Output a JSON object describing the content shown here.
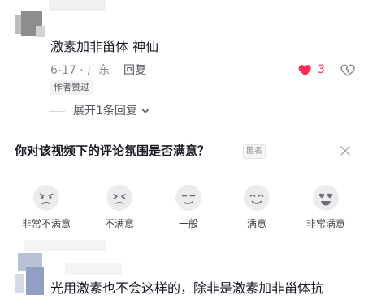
{
  "top_comment": {
    "text": "激素加非甾体 神仙",
    "date_location": "6-17 · 广东",
    "reply_label": "回复",
    "like_count": "3",
    "author_tag": "作者赞过",
    "expand_label": "展开1条回复"
  },
  "survey": {
    "question": "你对该视频下的评论氛围是否满意？",
    "anon_label": "匿名",
    "options": [
      {
        "label": "非常不满意"
      },
      {
        "label": "不满意"
      },
      {
        "label": "一般"
      },
      {
        "label": "满意"
      },
      {
        "label": "非常满意"
      }
    ]
  },
  "bottom_comment": {
    "text": "光用激素也不会这样的，除非是激素加非甾体抗"
  },
  "colors": {
    "like_red": "#fe2c55",
    "text_primary": "#161823",
    "text_secondary": "#8a8b91"
  },
  "icons": [
    "heart-filled-icon",
    "broken-heart-icon",
    "chevron-down-icon",
    "close-icon",
    "emoji-face-icon"
  ]
}
